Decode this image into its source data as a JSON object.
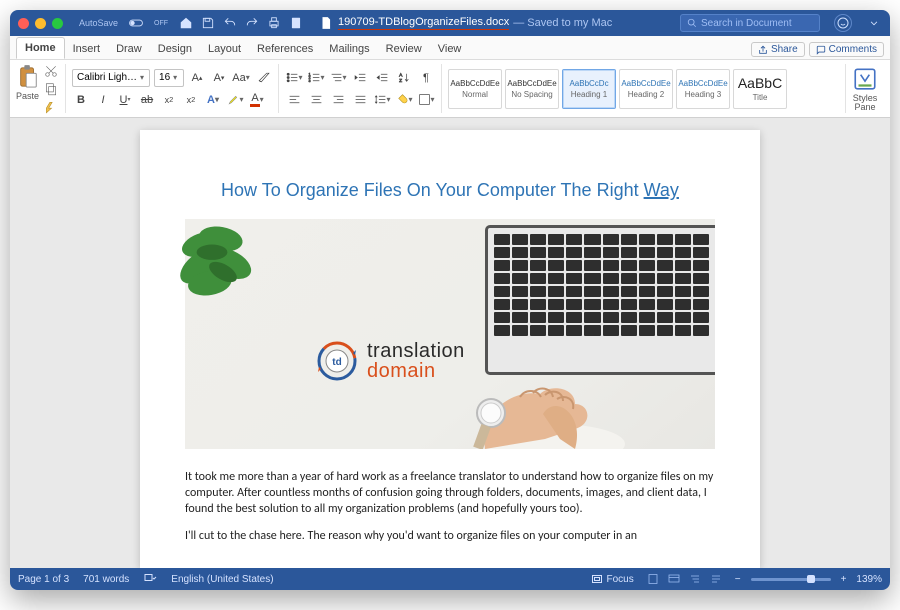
{
  "titlebar": {
    "autosave_label": "AutoSave",
    "autosave_state": "OFF",
    "filename": "190709-TDBlogOrganizeFiles.docx",
    "saved_text": "— Saved to my Mac",
    "search_placeholder": "Search in Document"
  },
  "tabs": [
    "Home",
    "Insert",
    "Draw",
    "Design",
    "Layout",
    "References",
    "Mailings",
    "Review",
    "View"
  ],
  "active_tab": "Home",
  "share_label": "Share",
  "comments_label": "Comments",
  "ribbon": {
    "paste_label": "Paste",
    "font_name": "Calibri Ligh…",
    "font_size": "16",
    "styles": [
      {
        "preview": "AaBbCcDdEe",
        "label": "Normal"
      },
      {
        "preview": "AaBbCcDdEe",
        "label": "No Spacing"
      },
      {
        "preview": "AaBbCcDc",
        "label": "Heading 1",
        "selected": true,
        "heading": true
      },
      {
        "preview": "AaBbCcDdEe",
        "label": "Heading 2",
        "heading": true
      },
      {
        "preview": "AaBbCcDdEe",
        "label": "Heading 3",
        "heading": true
      },
      {
        "preview": "AaBbC",
        "label": "Title",
        "big": true
      }
    ],
    "pane_label": "Styles\nPane"
  },
  "document": {
    "title_prefix": "How To Organize Files On Your Computer The Right ",
    "title_last": "Way",
    "logo_line1": "translation",
    "logo_line2": "domain",
    "para1": "It took me more than a year of hard work as a freelance translator to understand how to organize files on my computer. After countless months of confusion going through folders, documents, images, and client data, I found the best solution to all my organization problems (and hopefully yours too).",
    "para2": "I'll cut to the chase here. The reason why you'd want to organize files on your computer in an"
  },
  "statusbar": {
    "page": "Page 1 of 3",
    "words": "701 words",
    "lang": "English (United States)",
    "focus": "Focus",
    "zoom": "139%"
  }
}
